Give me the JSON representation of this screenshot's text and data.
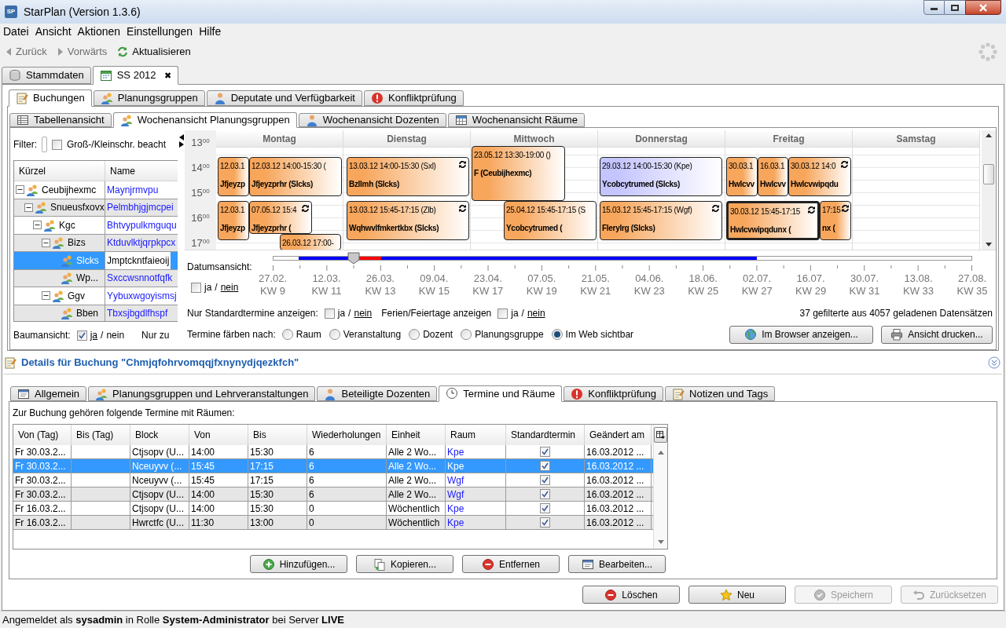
{
  "window": {
    "logo": "SP",
    "title": "StarPlan (Version 1.3.6)"
  },
  "menu": [
    "Datei",
    "Ansicht",
    "Aktionen",
    "Einstellungen",
    "Hilfe"
  ],
  "toolbar": [
    {
      "label": "Zurück",
      "disabled": true
    },
    {
      "label": "Vorwärts",
      "disabled": true
    },
    {
      "label": "Aktualisieren",
      "disabled": false
    }
  ],
  "main_tabs": [
    {
      "label": "Stammdaten",
      "selected": false
    },
    {
      "label": "SS 2012",
      "selected": true,
      "close": "✖"
    }
  ],
  "section_tabs": [
    {
      "label": "Buchungen",
      "selected": true
    },
    {
      "label": "Planungsgruppen",
      "selected": false
    },
    {
      "label": "Deputate und Verfügbarkeit",
      "selected": false
    },
    {
      "label": "Konfliktprüfung",
      "selected": false
    }
  ],
  "view_tabs": [
    {
      "label": "Tabellenansicht",
      "selected": false
    },
    {
      "label": "Wochenansicht Planungsgruppen",
      "selected": true
    },
    {
      "label": "Wochenansicht Dozenten",
      "selected": false
    },
    {
      "label": "Wochenansicht Räume",
      "selected": false
    }
  ],
  "filter": {
    "label": "Filter:",
    "case_label": "Groß-/Kleinschr. beacht",
    "case_checked": false
  },
  "tree": {
    "columns": [
      "Kürzel",
      "Name"
    ],
    "rows": [
      {
        "code": "Ceubijhexmc",
        "name": "Maynjrmvpu",
        "expanded": true,
        "selected": false,
        "children": [
          {
            "code": "Snueusfxovx",
            "name": "Pelmbhjgjmcpei",
            "expanded": true,
            "selected": false,
            "children": [
              {
                "code": "Kgc",
                "name": "Bhtvypulkmguqu",
                "expanded": true,
                "selected": false,
                "children": [
                  {
                    "code": "Bizs",
                    "name": "Ktduvlktjqrpkpcx",
                    "expanded": true,
                    "selected": false,
                    "children": [
                      {
                        "code": "Slcks",
                        "name": "Jmptckntfaieoij",
                        "selected": true
                      },
                      {
                        "code": "Wp...",
                        "name": "Sxccwsnnotfqfk",
                        "selected": false
                      }
                    ]
                  },
                  {
                    "code": "Ggv",
                    "name": "Yybuxwgoyismsj",
                    "expanded": true,
                    "selected": false,
                    "children": [
                      {
                        "code": "Bben",
                        "name": "Tbxsjbgdlfhspf",
                        "selected": false
                      }
                    ]
                  }
                ]
              }
            ]
          }
        ]
      }
    ]
  },
  "tree_view": {
    "label": "Baumansicht:",
    "checked": true,
    "yes": "ja",
    "separator": "/",
    "no": "nein",
    "extra": "Nur zu"
  },
  "calendar": {
    "hours": [
      "13$^{00}$",
      "14$^{00}$",
      "15$^{00}$",
      "16$^{00}$",
      "17$^{00}$"
    ],
    "days": [
      {
        "label": "Montag",
        "events": [
          {
            "time": "12.03.1",
            "title": "Jfjeyzp",
            "color": "#f7a65c",
            "sync": false,
            "selected": false
          },
          {
            "time": "12.03.12 14:00-15:30 (",
            "title": "Jfjeyzprhr (Slcks)",
            "color": "#f7a65c",
            "sync": false,
            "selected": false
          },
          {
            "time": "12.03.1",
            "title": "Jfjeyzp",
            "color": "#f7a65c",
            "sync": false,
            "selected": false
          },
          {
            "time": "07.05.12 15:4",
            "title": "Jfjeyzprhr (",
            "color": "#f7a65c",
            "sync": true,
            "selected": false
          },
          {
            "time": "26.03.12 17:00-",
            "color": "#f7a65c",
            "sync": false,
            "selected": false
          }
        ]
      },
      {
        "label": "Dienstag",
        "events": [
          {
            "time": "13.03.12 14:00-15:30 (Sxl)",
            "title": "Bzllmh (Slcks)",
            "color": "#f7a65c",
            "sync": true,
            "selected": false
          },
          {
            "time": "13.03.12 15:45-17:15 (Zlb)",
            "title": "Wqhwvlfmkertkbx (Slcks)",
            "color": "#f7a65c",
            "sync": true,
            "selected": false
          }
        ]
      },
      {
        "label": "Mittwoch",
        "events": [
          {
            "time": "23.05.12 13:30-19:00 ()",
            "title": "F (Ceubijhexmc)",
            "color": "#f7a65c",
            "sync": false,
            "selected": false
          },
          {
            "time": "25.04.12 15:45-17:15 (S",
            "title": "Ycobcytrumed (",
            "color": "#f7a65c",
            "sync": false,
            "selected": false
          }
        ]
      },
      {
        "label": "Donnerstag",
        "events": [
          {
            "time": "29.03.12 14:00-15:30 (Kpe)",
            "title": "Ycobcytrumed (Slcks)",
            "color": "#c4c4ff",
            "sync": false,
            "selected": false
          },
          {
            "time": "15.03.12 15:45-17:15 (Wgf)",
            "title": "Flerylrg (Slcks)",
            "color": "#f7a65c",
            "sync": true,
            "selected": false
          }
        ]
      },
      {
        "label": "Freitag",
        "events": [
          {
            "time": "30.03.1",
            "title": "Hwlcvv",
            "color": "#f7a65c",
            "sync": false,
            "selected": false
          },
          {
            "time": "16.03.1",
            "title": "Hwlcvv",
            "color": "#f7a65c",
            "sync": false,
            "selected": false
          },
          {
            "time": "30.03.12 14:0",
            "title": "Hwlcvwipqdu",
            "color": "#f7a65c",
            "sync": true,
            "selected": false
          },
          {
            "time": "30.03.12 15:45-17:15",
            "title": "Hwlcvwipqdunx (",
            "color": "#f7a65c",
            "sync": true,
            "selected": true
          },
          {
            "time": "17:15",
            "title": "nx (",
            "color": "#f7a65c",
            "sync": true,
            "selected": false
          }
        ]
      },
      {
        "label": "Samstag"
      }
    ]
  },
  "date_view": {
    "label": "Datumsansicht:",
    "checked": false,
    "yes": "ja",
    "separator": "/",
    "no": "nein",
    "level": 0.115,
    "ticks": [
      {
        "date": "27.02.",
        "week": "KW 9"
      },
      {
        "date": "12.03.",
        "week": "KW 11"
      },
      {
        "date": "26.03.",
        "week": "KW 13"
      },
      {
        "date": "09.04.",
        "week": "KW 15"
      },
      {
        "date": "23.04.",
        "week": "KW 17"
      },
      {
        "date": "07.05.",
        "week": "KW 19"
      },
      {
        "date": "21.05.",
        "week": "KW 21"
      },
      {
        "date": "04.06.",
        "week": "KW 23"
      },
      {
        "date": "18.06.",
        "week": "KW 25"
      },
      {
        "date": "02.07.",
        "week": "KW 27"
      },
      {
        "date": "16.07.",
        "week": "KW 29"
      },
      {
        "date": "30.07.",
        "week": "KW 31"
      },
      {
        "date": "13.08.",
        "week": "KW 33"
      },
      {
        "date": "27.08.",
        "week": "KW 35"
      }
    ]
  },
  "options": {
    "standard": {
      "label": "Nur Standardtermine anzeigen:",
      "checked": false,
      "yes": "ja",
      "separator": "/",
      "no": "nein"
    },
    "holidays": {
      "label": "Ferien/Feiertage anzeigen",
      "checked": false,
      "yes": "ja",
      "separator": "/",
      "no": "nein"
    },
    "count": "37 gefilterte aus 4057 geladenen Datensätzen",
    "color_by": {
      "label": "Termine färben nach:",
      "options": [
        {
          "label": "Raum",
          "selected": false
        },
        {
          "label": "Veranstaltung",
          "selected": false
        },
        {
          "label": "Dozent",
          "selected": false
        },
        {
          "label": "Planungsgruppe",
          "selected": false
        },
        {
          "label": "Im Web sichtbar",
          "selected": true
        }
      ]
    },
    "buttons": [
      "Im Browser anzeigen...",
      "Ansicht drucken..."
    ]
  },
  "details": {
    "title": "Details für Buchung \"Chmjqfohrvomqqjfxnynydjqezkfch\"",
    "tabs": [
      {
        "label": "Allgemein",
        "selected": false
      },
      {
        "label": "Planungsgruppen und Lehrveranstaltungen",
        "selected": false
      },
      {
        "label": "Beteiligte Dozenten",
        "selected": false
      },
      {
        "label": "Termine und Räume",
        "selected": true
      },
      {
        "label": "Konfliktprüfung",
        "selected": false
      },
      {
        "label": "Notizen und Tags",
        "selected": false
      }
    ],
    "caption": "Zur Buchung gehören folgende Termine mit Räumen:",
    "columns": [
      "Von (Tag)",
      "Bis (Tag)",
      "Block",
      "Von",
      "Bis",
      "Wiederholungen",
      "Einheit",
      "Raum",
      "Standardtermin",
      "Geändert am"
    ],
    "rows": [
      {
        "from_day": "Fr 30.03.2...",
        "block": "Ctjsopv (U...",
        "from": "14:00",
        "to": "15:30",
        "repeats": "6",
        "unit": "Alle 2 Wo...",
        "room": "Kpe",
        "standard": true,
        "changed": "16.03.2012 ...",
        "selected": false
      },
      {
        "from_day": "Fr 30.03.2...",
        "block": "Nceuyvv (...",
        "from": "15:45",
        "to": "17:15",
        "repeats": "6",
        "unit": "Alle 2 Wo...",
        "room": "Kpe",
        "standard": true,
        "changed": "16.03.2012 ...",
        "selected": true
      },
      {
        "from_day": "Fr 30.03.2...",
        "block": "Nceuyvv (...",
        "from": "15:45",
        "to": "17:15",
        "repeats": "6",
        "unit": "Alle 2 Wo...",
        "room": "Wgf",
        "standard": true,
        "changed": "16.03.2012 ...",
        "selected": false
      },
      {
        "from_day": "Fr 30.03.2...",
        "block": "Ctjsopv (U...",
        "from": "14:00",
        "to": "15:30",
        "repeats": "6",
        "unit": "Alle 2 Wo...",
        "room": "Wgf",
        "standard": true,
        "changed": "16.03.2012 ...",
        "selected": false
      },
      {
        "from_day": "Fr 16.03.2...",
        "block": "Ctjsopv (U...",
        "from": "14:00",
        "to": "15:30",
        "repeats": "0",
        "unit": "Wöchentlich",
        "room": "Kpe",
        "standard": true,
        "changed": "16.03.2012 ...",
        "selected": false
      },
      {
        "from_day": "Fr 16.03.2...",
        "block": "Hwrctfc (U...",
        "from": "11:30",
        "to": "13:00",
        "repeats": "0",
        "unit": "Wöchentlich",
        "room": "Kpe",
        "standard": true,
        "changed": "16.03.2012 ...",
        "selected": false
      }
    ],
    "buttons": [
      "Hinzufügen...",
      "Kopieren...",
      "Entfernen",
      "Bearbeiten..."
    ]
  },
  "actions": [
    {
      "label": "Löschen",
      "disabled": false
    },
    {
      "label": "Neu",
      "disabled": false
    },
    {
      "label": "Speichern",
      "disabled": true
    },
    {
      "label": "Zurücksetzen",
      "disabled": true
    }
  ],
  "status_bar": "Angemeldet als **sysadmin** in Rolle **System-Administrator** bei Server **LIVE**"
}
